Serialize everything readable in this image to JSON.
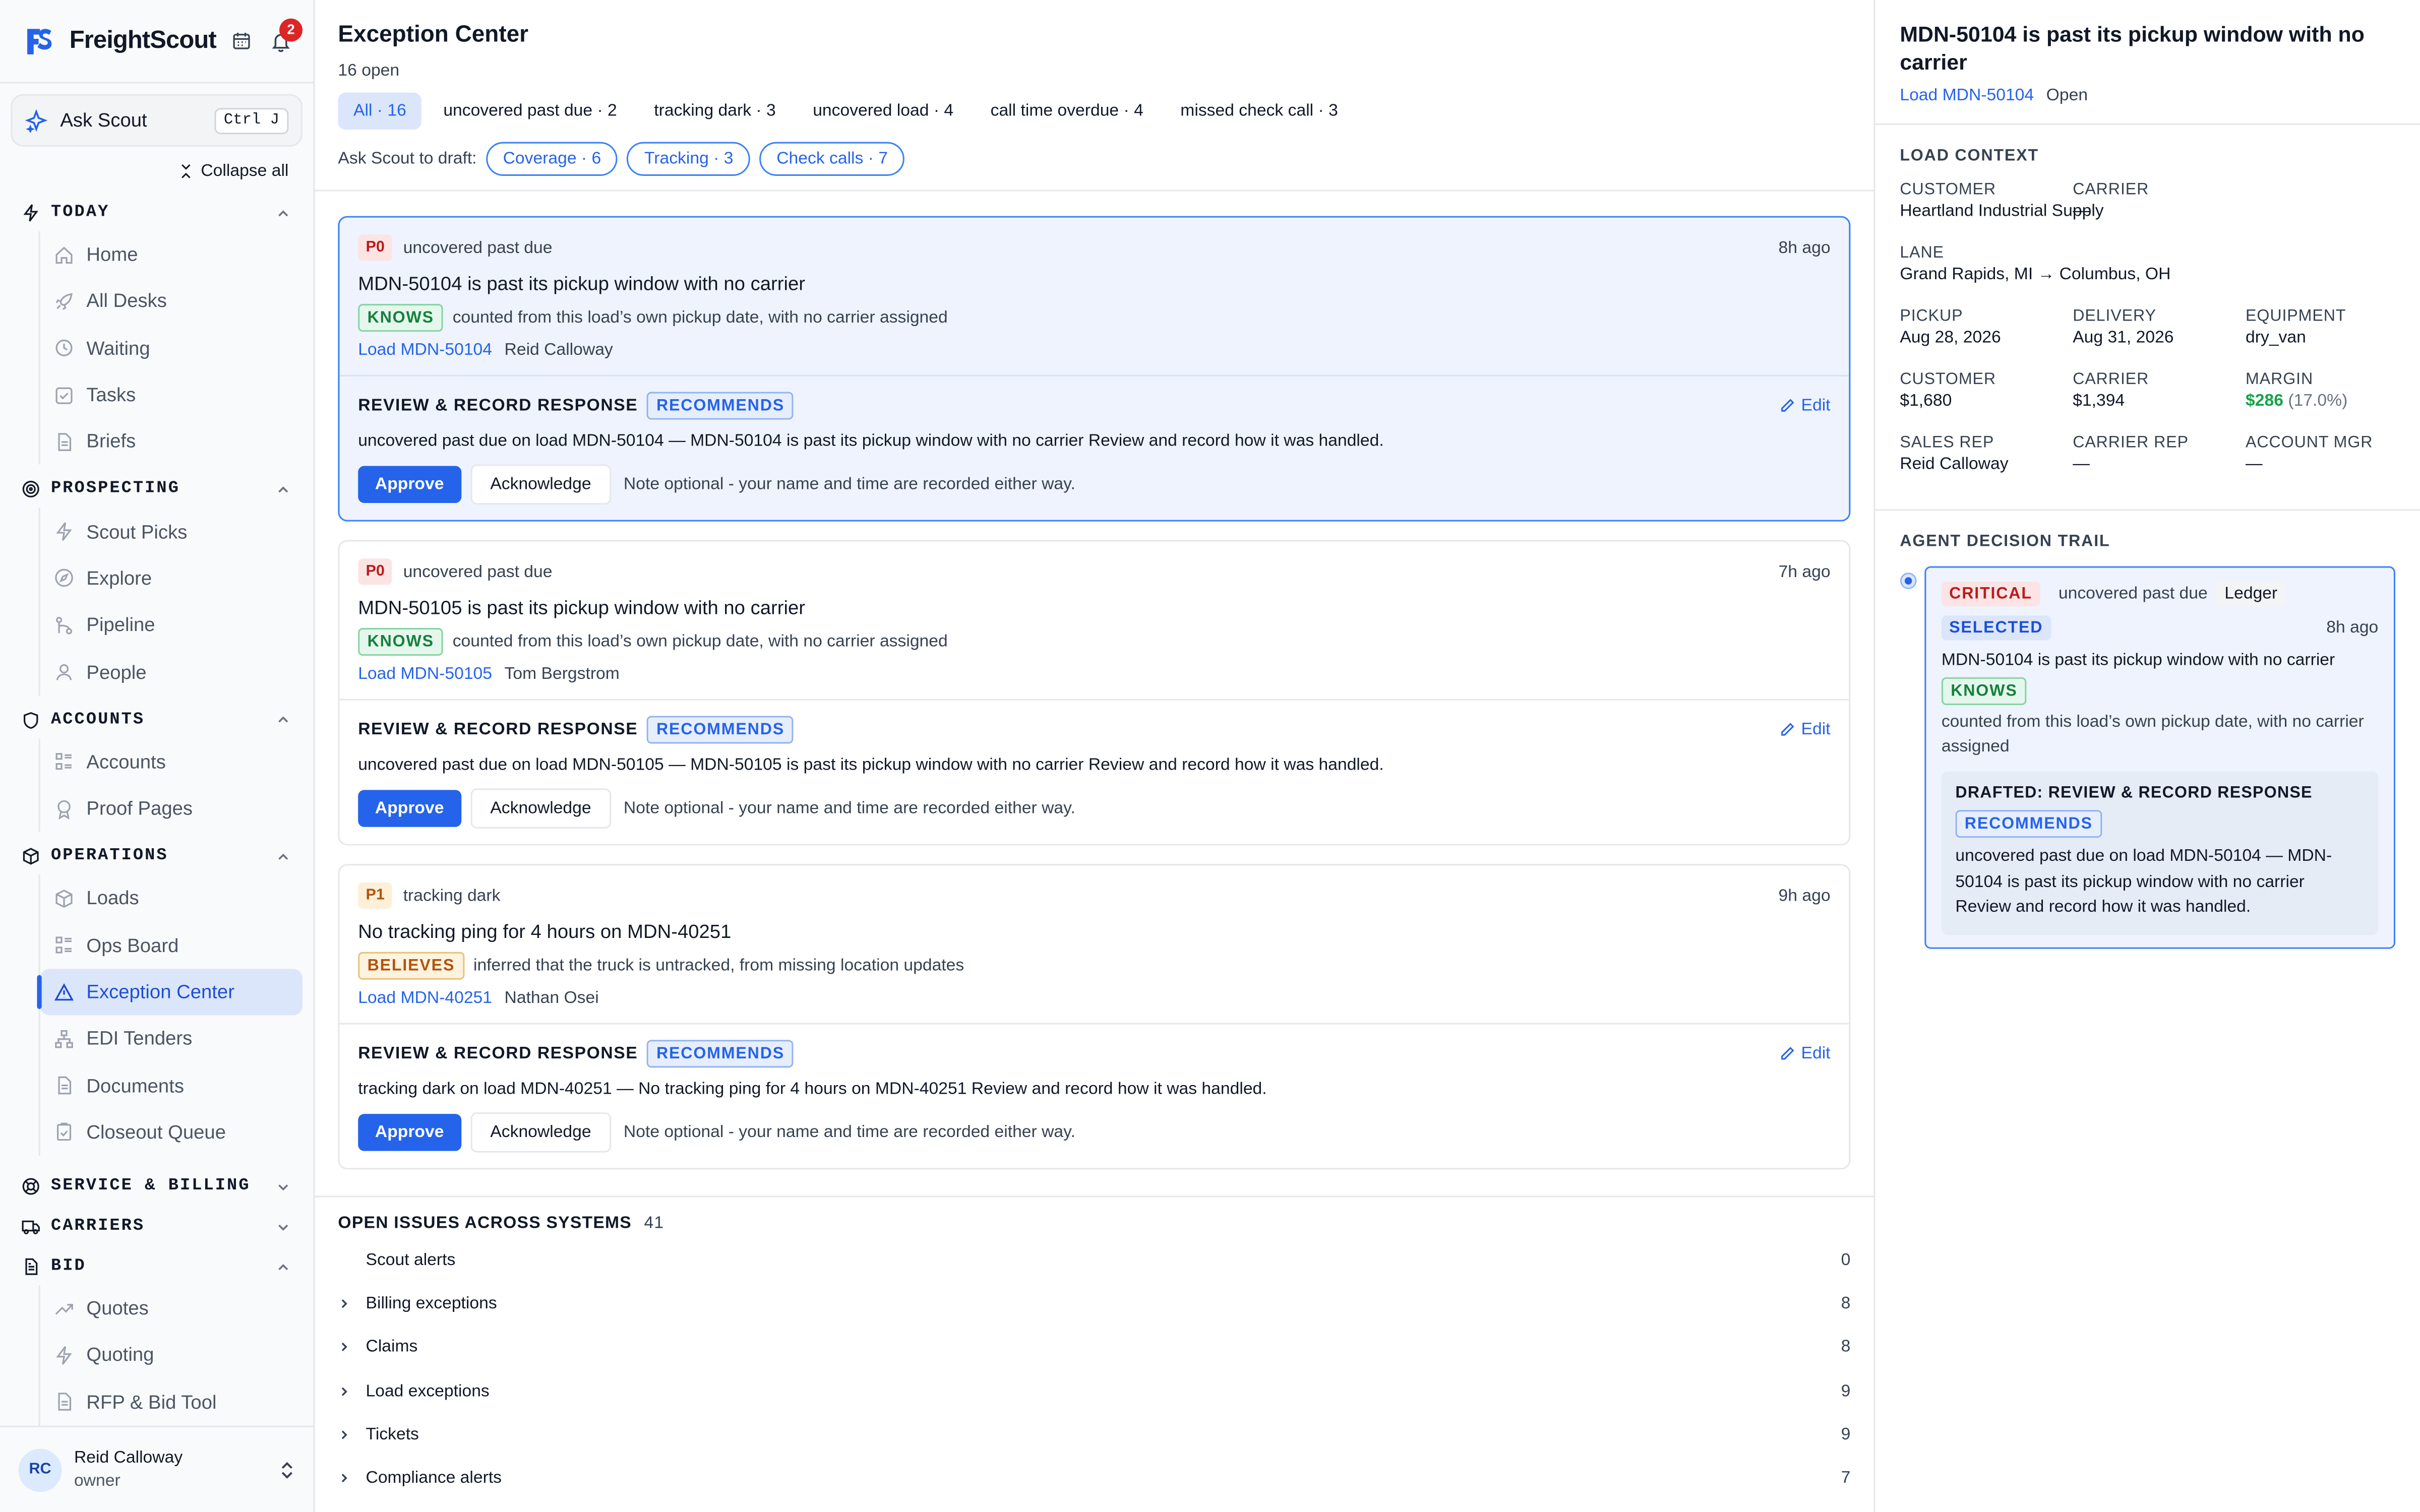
{
  "app": {
    "name": "FreightScout",
    "notification_count": "2"
  },
  "ask": {
    "label": "Ask Scout",
    "shortcut": "Ctrl J"
  },
  "collapse_all": "Collapse all",
  "sidebar": {
    "today": {
      "label": "TODAY",
      "items": [
        "Home",
        "All Desks",
        "Waiting",
        "Tasks",
        "Briefs"
      ]
    },
    "prospecting": {
      "label": "PROSPECTING",
      "items": [
        "Scout Picks",
        "Explore",
        "Pipeline",
        "People"
      ]
    },
    "accounts": {
      "label": "ACCOUNTS",
      "items": [
        "Accounts",
        "Proof Pages"
      ]
    },
    "operations": {
      "label": "OPERATIONS",
      "items": [
        "Loads",
        "Ops Board",
        "Exception Center",
        "EDI Tenders",
        "Documents",
        "Closeout Queue"
      ]
    },
    "service_billing": {
      "label": "SERVICE & BILLING"
    },
    "carriers": {
      "label": "CARRIERS"
    },
    "bid": {
      "label": "BID",
      "items": [
        "Quotes",
        "Quoting",
        "RFP & Bid Tool"
      ]
    }
  },
  "user": {
    "initials": "RC",
    "name": "Reid Calloway",
    "role": "owner"
  },
  "main": {
    "title": "Exception Center",
    "open_count": "16 open",
    "tabs": [
      "All · 16",
      "uncovered past due · 2",
      "tracking dark · 3",
      "uncovered load · 4",
      "call time overdue · 4",
      "missed check call · 3"
    ],
    "draft_label": "Ask Scout to draft:",
    "draft_pills": [
      "Coverage · 6",
      "Tracking · 3",
      "Check calls · 7"
    ]
  },
  "cards": [
    {
      "priority": "P0",
      "category": "uncovered past due",
      "ago": "8h ago",
      "title": "MDN-50104 is past its pickup window with no carrier",
      "evidence_tag": "KNOWS",
      "evidence": "counted from this load’s own pickup date, with no carrier assigned",
      "load_link": "Load MDN-50104",
      "owner": "Reid Calloway",
      "resp_title": "REVIEW & RECORD RESPONSE",
      "resp_tag": "RECOMMENDS",
      "edit": "Edit",
      "resp_text": "uncovered past due on load MDN-50104 — MDN-50104 is past its pickup window with no carrier Review and record how it was handled.",
      "approve": "Approve",
      "acknowledge": "Acknowledge",
      "note": "Note optional - your name and time are recorded either way."
    },
    {
      "priority": "P0",
      "category": "uncovered past due",
      "ago": "7h ago",
      "title": "MDN-50105 is past its pickup window with no carrier",
      "evidence_tag": "KNOWS",
      "evidence": "counted from this load’s own pickup date, with no carrier assigned",
      "load_link": "Load MDN-50105",
      "owner": "Tom Bergstrom",
      "resp_title": "REVIEW & RECORD RESPONSE",
      "resp_tag": "RECOMMENDS",
      "edit": "Edit",
      "resp_text": "uncovered past due on load MDN-50105 — MDN-50105 is past its pickup window with no carrier Review and record how it was handled.",
      "approve": "Approve",
      "acknowledge": "Acknowledge",
      "note": "Note optional - your name and time are recorded either way."
    },
    {
      "priority": "P1",
      "category": "tracking dark",
      "ago": "9h ago",
      "title": "No tracking ping for 4 hours on MDN-40251",
      "evidence_tag": "BELIEVES",
      "evidence": "inferred that the truck is untracked, from missing location updates",
      "load_link": "Load MDN-40251",
      "owner": "Nathan Osei",
      "resp_title": "REVIEW & RECORD RESPONSE",
      "resp_tag": "RECOMMENDS",
      "edit": "Edit",
      "resp_text": "tracking dark on load MDN-40251 — No tracking ping for 4 hours on MDN-40251 Review and record how it was handled.",
      "approve": "Approve",
      "acknowledge": "Acknowledge",
      "note": "Note optional - your name and time are recorded either way."
    }
  ],
  "issues": {
    "title": "OPEN ISSUES ACROSS SYSTEMS",
    "count": "41",
    "rows": [
      {
        "label": "Scout alerts",
        "count": "0"
      },
      {
        "label": "Billing exceptions",
        "count": "8"
      },
      {
        "label": "Claims",
        "count": "8"
      },
      {
        "label": "Load exceptions",
        "count": "9"
      },
      {
        "label": "Tickets",
        "count": "9"
      },
      {
        "label": "Compliance alerts",
        "count": "7"
      }
    ]
  },
  "panel": {
    "title": "MDN-50104 is past its pickup window with no carrier",
    "load_link": "Load MDN-50104",
    "status": "Open",
    "context_title": "LOAD CONTEXT",
    "customer_label": "CUSTOMER",
    "customer": "Heartland Industrial Supply",
    "carrier_label": "CARRIER",
    "carrier": "—",
    "lane_label": "LANE",
    "lane": "Grand Rapids, MI → Columbus, OH",
    "pickup_label": "PICKUP",
    "pickup": "Aug 28, 2026",
    "delivery_label": "DELIVERY",
    "delivery": "Aug 31, 2026",
    "equipment_label": "EQUIPMENT",
    "equipment": "dry_van",
    "cust_rate_label": "CUSTOMER",
    "cust_rate": "$1,680",
    "carrier_rate_label": "CARRIER",
    "carrier_rate": "$1,394",
    "margin_label": "MARGIN",
    "margin": "$286",
    "margin_pct": "(17.0%)",
    "sales_rep_label": "SALES REP",
    "sales_rep": "Reid Calloway",
    "carrier_rep_label": "CARRIER REP",
    "carrier_rep": "—",
    "account_mgr_label": "ACCOUNT MGR",
    "account_mgr": "—",
    "trail_title": "AGENT DECISION TRAIL",
    "trail": {
      "severity": "CRITICAL",
      "category": "uncovered past due",
      "source": "Ledger",
      "state": "SELECTED",
      "ago": "8h ago",
      "title": "MDN-50104 is past its pickup window with no carrier",
      "tag": "KNOWS",
      "basis": "counted from this load’s own pickup date, with no carrier assigned",
      "drafted_title": "DRAFTED: REVIEW & RECORD RESPONSE",
      "drafted_tag": "RECOMMENDS",
      "drafted_text": "uncovered past due on load MDN-50104 — MDN-50104 is past its pickup window with no carrier Review and record how it was handled."
    }
  },
  "colors": {
    "accent": "#2563eb",
    "active_bg": "#dbe6fb",
    "danger": "#dc2626",
    "success": "#16a34a"
  }
}
